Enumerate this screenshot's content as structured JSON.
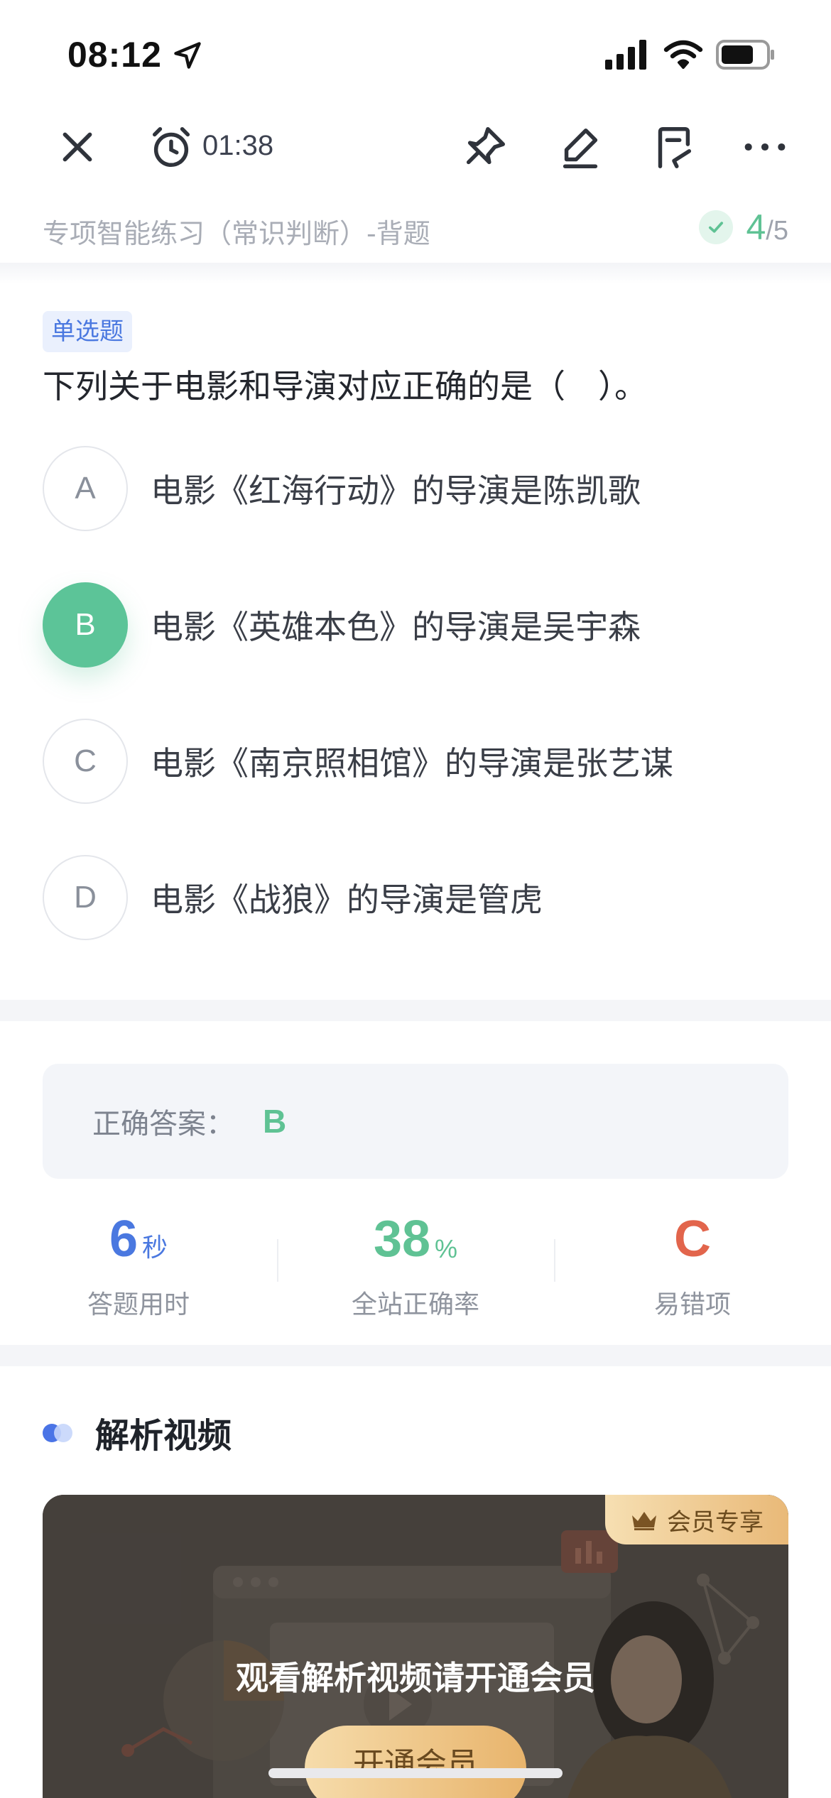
{
  "status_bar": {
    "time": "08:12"
  },
  "toolbar": {
    "timer": "01:38"
  },
  "header": {
    "subtitle": "专项智能练习（常识判断）-背题",
    "progress_current": "4",
    "progress_total": "/5"
  },
  "question": {
    "type_tag": "单选题",
    "text": "下列关于电影和导演对应正确的是（　）。",
    "options": [
      {
        "letter": "A",
        "text": "电影《红海行动》的导演是陈凯歌",
        "selected": false
      },
      {
        "letter": "B",
        "text": "电影《英雄本色》的导演是吴宇森",
        "selected": true
      },
      {
        "letter": "C",
        "text": "电影《南京照相馆》的导演是张艺谋",
        "selected": false
      },
      {
        "letter": "D",
        "text": "电影《战狼》的导演是管虎",
        "selected": false
      }
    ]
  },
  "answer": {
    "label": "正确答案：",
    "value": "B"
  },
  "stats": [
    {
      "value": "6",
      "unit": "秒",
      "label": "答题用时",
      "color": "#4a78e0"
    },
    {
      "value": "38",
      "unit": "%",
      "label": "全站正确率",
      "color": "#5fc294"
    },
    {
      "value": "C",
      "unit": "",
      "label": "易错项",
      "color": "#e2654c"
    }
  ],
  "video": {
    "heading": "解析视频",
    "vip_badge": "会员专享",
    "message": "观看解析视频请开通会员",
    "button": "开通会员"
  },
  "colors": {
    "accent_green": "#5cc498",
    "accent_blue": "#4a78e0",
    "error_red": "#e2654c"
  }
}
